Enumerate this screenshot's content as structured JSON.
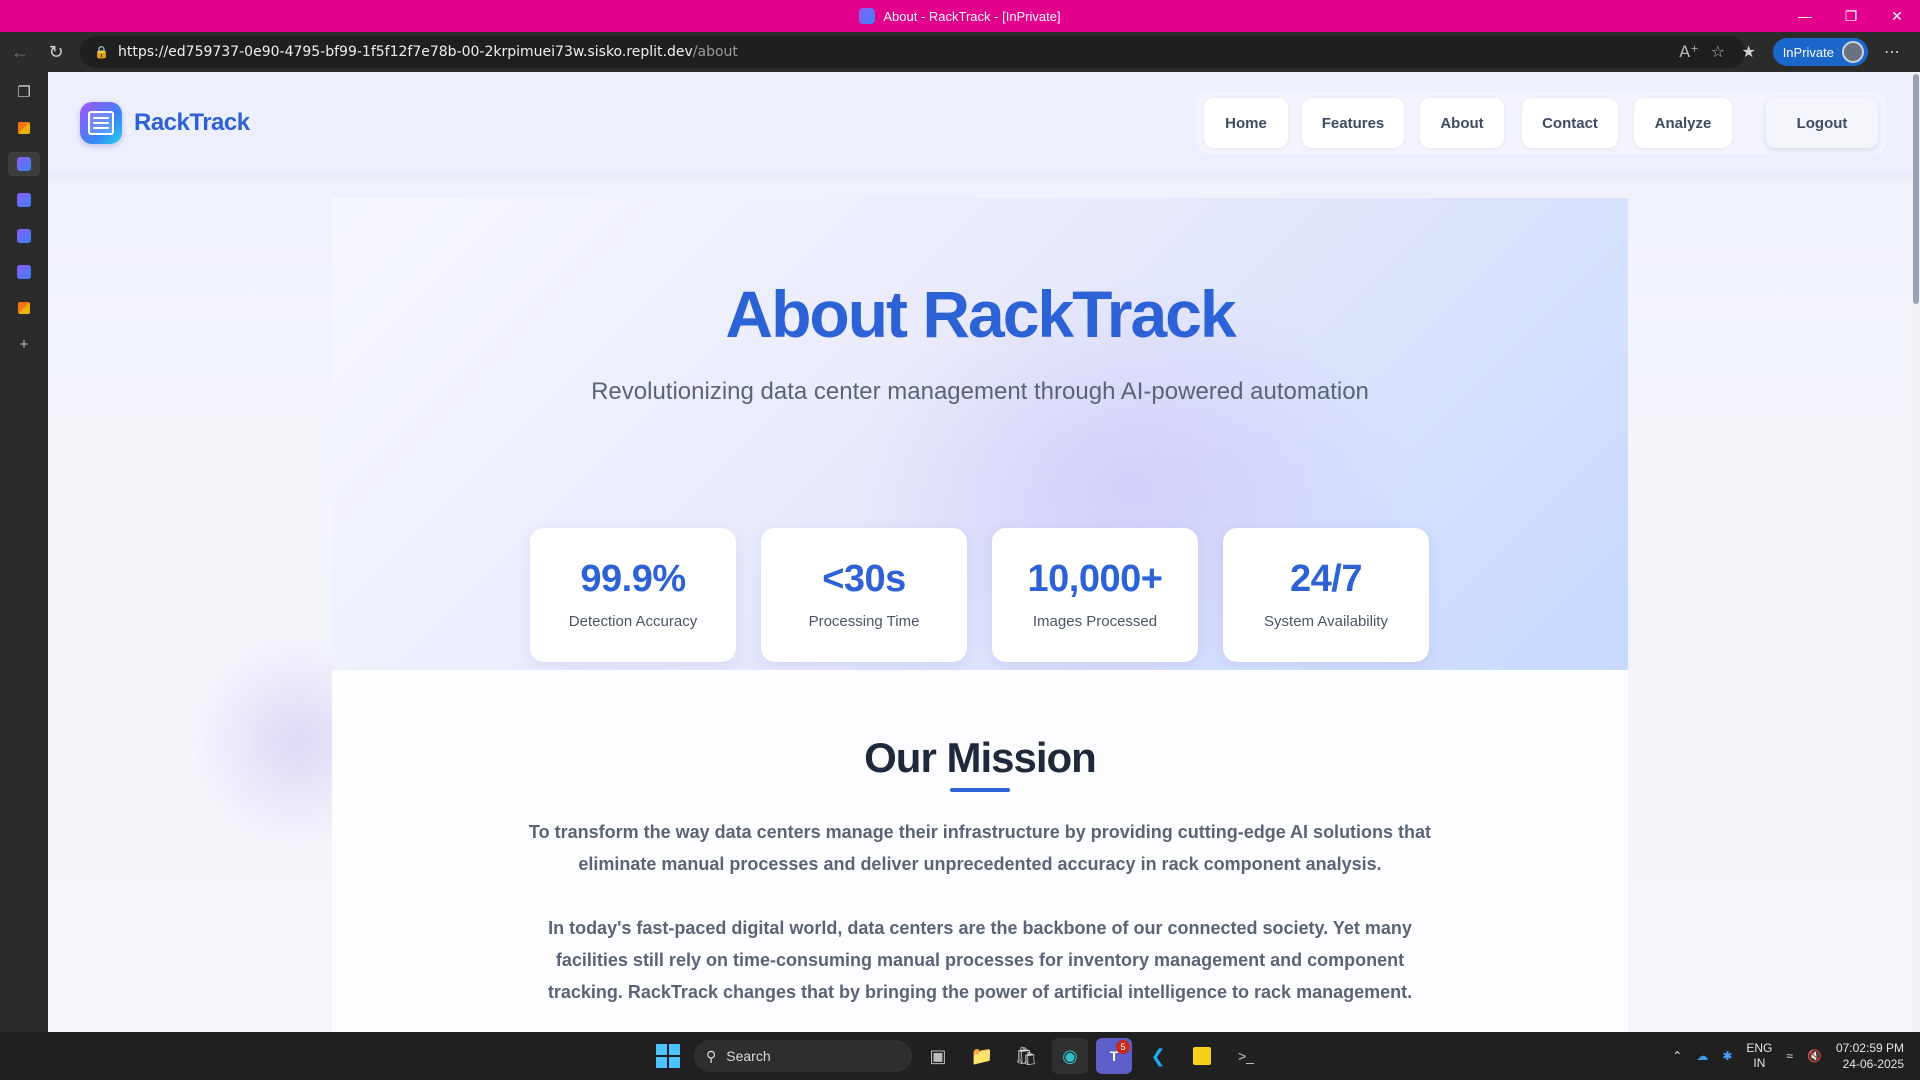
{
  "browser": {
    "window_title": "About - RackTrack - [InPrivate]",
    "url_host": "https://ed759737-0e90-4795-bf99-1f5f12f7e78b-00-2krpimuei73w.sisko.replit.dev",
    "url_path": "/about",
    "inprivate_label": "InPrivate"
  },
  "site": {
    "brand": "RackTrack",
    "nav": [
      {
        "label": "Home"
      },
      {
        "label": "Features"
      },
      {
        "label": "About"
      },
      {
        "label": "Contact"
      },
      {
        "label": "Analyze"
      },
      {
        "label": "Logout"
      }
    ]
  },
  "hero": {
    "title": "About RackTrack",
    "subtitle": "Revolutionizing data center management through AI-powered automation",
    "stats": [
      {
        "value": "99.9%",
        "label": "Detection Accuracy"
      },
      {
        "value": "<30s",
        "label": "Processing Time"
      },
      {
        "value": "10,000+",
        "label": "Images Processed"
      },
      {
        "value": "24/7",
        "label": "System Availability"
      }
    ]
  },
  "mission": {
    "title": "Our Mission",
    "p1": "To transform the way data centers manage their infrastructure by providing cutting-edge AI solutions that eliminate manual processes and deliver unprecedented accuracy in rack component analysis.",
    "p2": "In today's fast-paced digital world, data centers are the backbone of our connected society. Yet many facilities still rely on time-consuming manual processes for inventory management and component tracking. RackTrack changes that by bringing the power of artificial intelligence to rack management."
  },
  "taskbar": {
    "search_placeholder": "Search",
    "teams_badge": "5",
    "lang_top": "ENG",
    "lang_bottom": "IN",
    "time": "07:02:59 PM",
    "date": "24-06-2025"
  },
  "colors": {
    "titlebar": "#e3008c",
    "brand_blue": "#2d62d6"
  }
}
